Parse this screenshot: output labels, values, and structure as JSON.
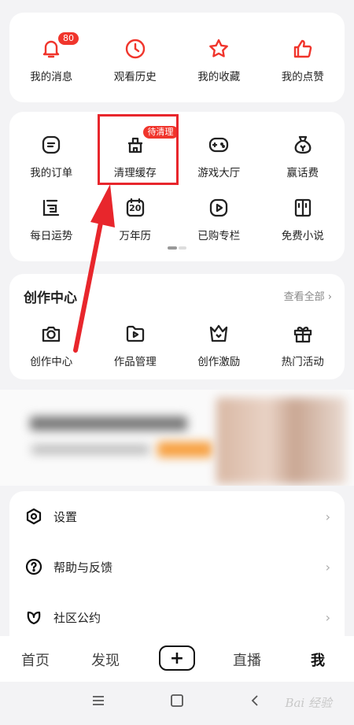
{
  "top_row": {
    "items": [
      {
        "label": "我的消息",
        "icon": "bell-icon",
        "badge": "80"
      },
      {
        "label": "观看历史",
        "icon": "clock-icon"
      },
      {
        "label": "我的收藏",
        "icon": "star-icon"
      },
      {
        "label": "我的点赞",
        "icon": "thumbs-up-icon"
      }
    ]
  },
  "services": {
    "row1": [
      {
        "label": "我的订单",
        "icon": "order-icon"
      },
      {
        "label": "清理缓存",
        "icon": "clean-cache-icon",
        "badge": "待清理"
      },
      {
        "label": "游戏大厅",
        "icon": "gamepad-icon"
      },
      {
        "label": "赢话费",
        "icon": "money-bag-icon"
      }
    ],
    "row2": [
      {
        "label": "每日运势",
        "icon": "fortune-icon"
      },
      {
        "label": "万年历",
        "icon": "calendar-icon",
        "icon_text": "20"
      },
      {
        "label": "已购专栏",
        "icon": "play-square-icon"
      },
      {
        "label": "免费小说",
        "icon": "book-icon"
      }
    ]
  },
  "creator": {
    "title": "创作中心",
    "more": "查看全部",
    "items": [
      {
        "label": "创作中心",
        "icon": "camera-icon"
      },
      {
        "label": "作品管理",
        "icon": "folder-play-icon"
      },
      {
        "label": "创作激励",
        "icon": "crown-icon"
      },
      {
        "label": "热门活动",
        "icon": "gift-icon"
      }
    ]
  },
  "menu_list": [
    {
      "label": "设置",
      "icon": "settings-hexagon-icon"
    },
    {
      "label": "帮助与反馈",
      "icon": "help-circle-icon"
    },
    {
      "label": "社区公约",
      "icon": "leaf-icon"
    }
  ],
  "tabbar": {
    "home": "首页",
    "discover": "发现",
    "plus": "+",
    "live": "直播",
    "me": "我"
  },
  "watermark": "Bai 经验",
  "colors": {
    "accent": "#f0352c",
    "highlight_box": "#e8262c",
    "icon_red": "#f0352c",
    "icon_dark": "#222222",
    "background": "#f3f3f5"
  }
}
